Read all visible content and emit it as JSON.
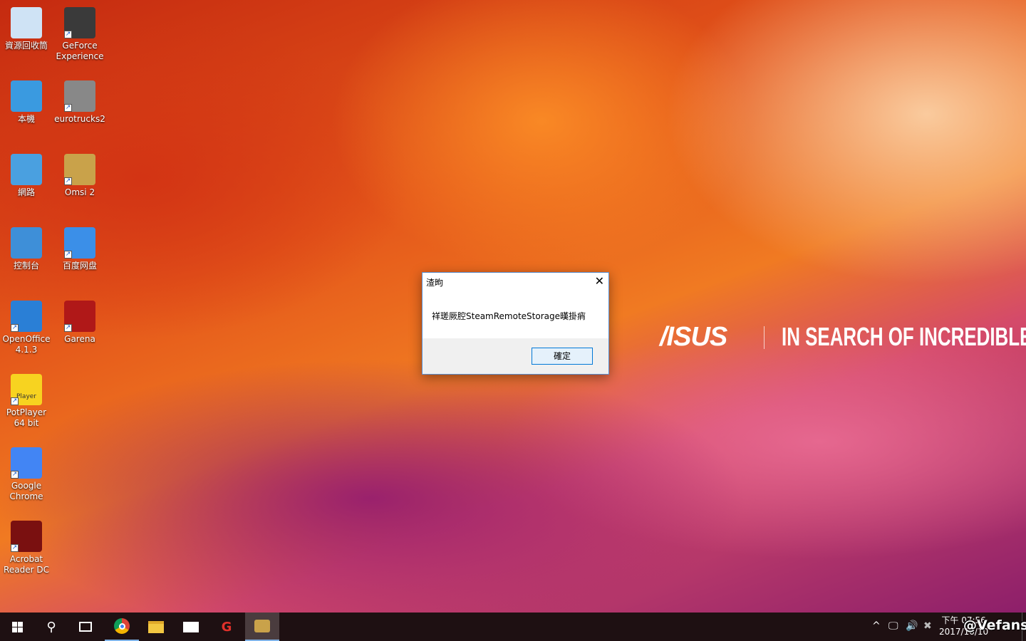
{
  "desktop": {
    "icons": [
      {
        "label": "資源回收筒",
        "icon": "recycle-bin",
        "color": "#cfe3f5"
      },
      {
        "label": "GeForce Experience",
        "icon": "geforce",
        "color": "#3a3a3a"
      },
      {
        "label": "本機",
        "icon": "computer",
        "color": "#3a9ae0"
      },
      {
        "label": "eurotrucks2",
        "icon": "truck",
        "color": "#888"
      },
      {
        "label": "網路",
        "icon": "network",
        "color": "#4aa0e0"
      },
      {
        "label": "Omsi 2",
        "icon": "bus",
        "color": "#c9a24a"
      },
      {
        "label": "控制台",
        "icon": "control-panel",
        "color": "#3e8fd8"
      },
      {
        "label": "百度网盘",
        "icon": "baidu-cloud",
        "color": "#3b8fe8"
      },
      {
        "label": "OpenOffice 4.1.3",
        "icon": "openoffice",
        "color": "#2a7fd6"
      },
      {
        "label": "Garena",
        "icon": "garena",
        "color": "#b01818"
      },
      {
        "label": "PotPlayer 64 bit",
        "icon": "potplayer",
        "color": "#f7d320",
        "glyph": "Player"
      },
      {
        "label": "Google Chrome",
        "icon": "chrome",
        "color": "#4285f4"
      },
      {
        "label": "Acrobat Reader DC",
        "icon": "acrobat",
        "color": "#7a1010"
      }
    ]
  },
  "branding": {
    "asus": "/ISUS",
    "slogan": "IN SEARCH OF INCREDIBLE"
  },
  "dialog": {
    "title": "渣昫",
    "message": "祥瑳厥腔SteamRemoteStorage暵掛痟",
    "ok": "確定",
    "close": "✕"
  },
  "taskbar": {
    "items": [
      "start",
      "search",
      "task-view",
      "chrome",
      "file-explorer",
      "mail",
      "garena",
      "omsi-2"
    ]
  },
  "tray": {
    "chevron": "^",
    "network": "🖵",
    "volume": "🔊",
    "x": "✖",
    "time": "下午 07:56",
    "date": "2017/10/10"
  },
  "watermark": "@Vefans"
}
